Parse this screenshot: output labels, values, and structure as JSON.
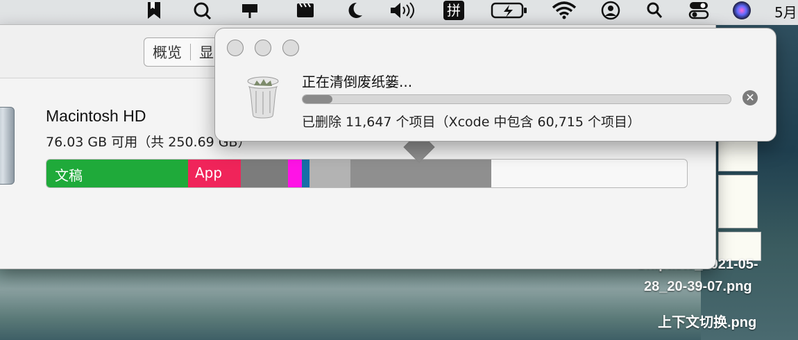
{
  "menubar": {
    "input_method_label": "拼",
    "date_label": "5月"
  },
  "storage": {
    "tabs": [
      "概览",
      "显"
    ],
    "disk_name": "Macintosh HD",
    "disk_subtitle": "76.03 GB 可用（共 250.69 GB）",
    "segments": [
      {
        "label": "文稿",
        "color": "#1faa3a"
      },
      {
        "label": "App",
        "color": "#f0245a"
      },
      {
        "label": "",
        "color": "#7c7c7c"
      },
      {
        "label": "",
        "color": "#ff13e6"
      },
      {
        "label": "",
        "color": "#176ea8"
      },
      {
        "label": "",
        "color": "#b3b3b3"
      },
      {
        "label": "",
        "color": "#8f8f8f"
      }
    ]
  },
  "popover": {
    "title": "正在清倒废纸篓...",
    "status": "已删除 11,647 个项目（Xcode 中包含 60,715 个项目）",
    "progress_fraction": 0.07
  },
  "desktop": {
    "labels": [
      "Snipaste_2021-05-",
      "28_20-39-07.png",
      "上下文切换.png"
    ]
  }
}
